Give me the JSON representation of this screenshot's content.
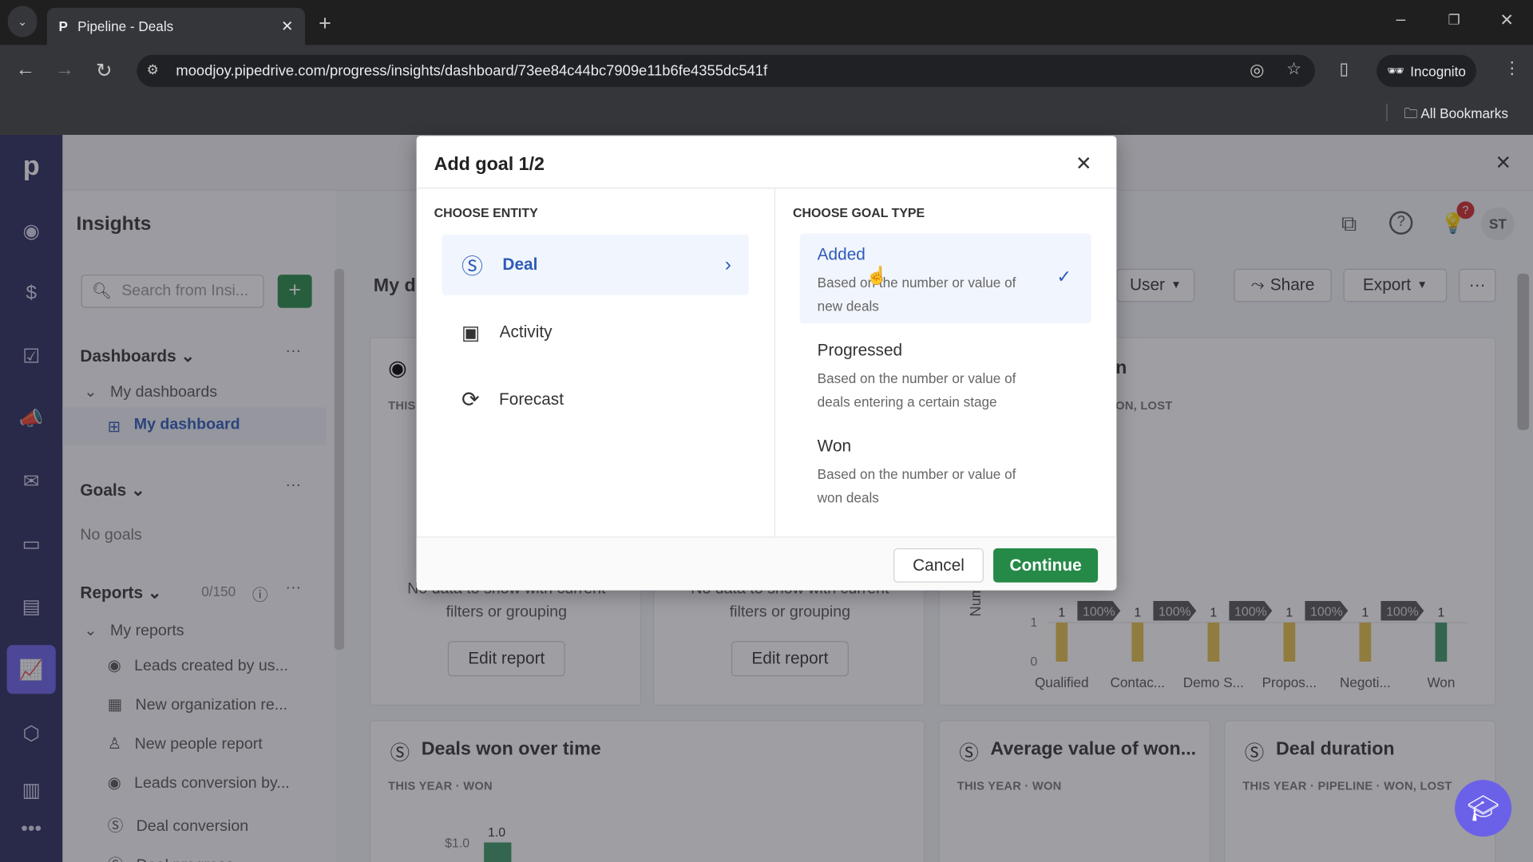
{
  "browser": {
    "tab_title": "Pipeline - Deals",
    "url": "moodjoy.pipedrive.com/progress/insights/dashboard/73ee84c44bc7909e11b6fe4355dc541f",
    "incognito_label": "Incognito",
    "bookmarks_label": "All Bookmarks"
  },
  "app": {
    "page_title": "Insights",
    "search_placeholder": "Search from Insi...",
    "avatar": "ST",
    "notification_badge": "?",
    "sidebar": {
      "dashboards_label": "Dashboards",
      "my_dashboards": "My dashboards",
      "my_dashboard": "My dashboard",
      "goals_label": "Goals",
      "no_goals": "No goals",
      "reports_label": "Reports",
      "reports_count": "0/150",
      "my_reports": "My reports",
      "reports": [
        {
          "label": "Leads created by us...",
          "icon": "target-icon"
        },
        {
          "label": "New organization re...",
          "icon": "building-icon"
        },
        {
          "label": "New people report",
          "icon": "person-icon"
        },
        {
          "label": "Leads conversion by...",
          "icon": "target-icon"
        },
        {
          "label": "Deal conversion",
          "icon": "dollar-icon"
        },
        {
          "label": "Deal progress",
          "icon": "dollar-icon"
        }
      ]
    },
    "main": {
      "dashboard_title": "My d",
      "user_filter": "User",
      "share": "Share",
      "export": "Export",
      "card1": {
        "sub": "THIS",
        "empty_a": "No data to show with current",
        "empty_b": "filters or grouping",
        "button": "Edit report"
      },
      "card2": {
        "empty_a": "No data to show with current",
        "empty_b": "filters or grouping",
        "button": "Edit report"
      },
      "card3": {
        "title_fragment": "n",
        "sub": "ON, LOST",
        "ylabel": "Numbe"
      },
      "card4": {
        "title": "Deals won over time",
        "sub_a": "THIS YEAR",
        "sub_b": "WON",
        "ytick": "$1.0",
        "bar_label": "1.0"
      },
      "card5": {
        "title": "Average value of won...",
        "sub_a": "THIS YEAR",
        "sub_b": "WON"
      },
      "card6": {
        "title": "Deal duration",
        "sub_a": "THIS YEAR",
        "sub_b": "PIPELINE",
        "sub_c": "WON, LOST"
      }
    },
    "funnel": {
      "categories": [
        "Qualified",
        "Contac...",
        "Demo S...",
        "Propos...",
        "Negoti...",
        "Won"
      ],
      "values": [
        1,
        1,
        1,
        1,
        1,
        1
      ],
      "conversion": [
        "100%",
        "100%",
        "100%",
        "100%",
        "100%"
      ],
      "yticks": [
        "0",
        "1"
      ],
      "colors": {
        "stage": "#e8c14a",
        "won": "#3f9a66"
      }
    }
  },
  "modal": {
    "title": "Add goal 1/2",
    "entity_label": "CHOOSE ENTITY",
    "entities": [
      {
        "label": "Deal",
        "icon": "dollar-icon",
        "selected": true
      },
      {
        "label": "Activity",
        "icon": "calendar-icon"
      },
      {
        "label": "Forecast",
        "icon": "forecast-icon"
      }
    ],
    "goal_type_label": "CHOOSE GOAL TYPE",
    "goal_types": [
      {
        "title": "Added",
        "desc": "Based on the number or value of new deals",
        "selected": true
      },
      {
        "title": "Progressed",
        "desc": "Based on the number or value of deals entering a certain stage"
      },
      {
        "title": "Won",
        "desc": "Based on the number or value of won deals"
      }
    ],
    "cancel": "Cancel",
    "continue": "Continue",
    "colors": {
      "accent": "#2d5bb8",
      "primary": "#258a47"
    }
  }
}
